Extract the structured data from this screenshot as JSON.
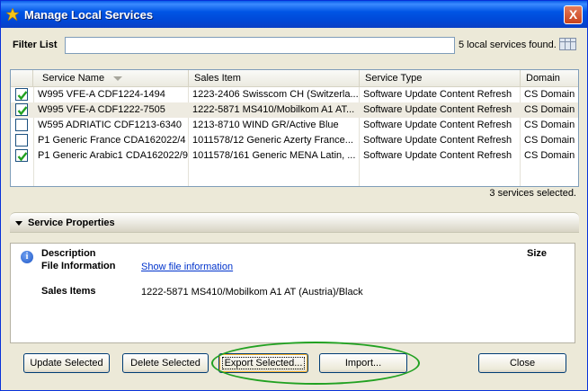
{
  "window": {
    "title": "Manage Local Services",
    "close_label": "X"
  },
  "filter": {
    "label": "Filter List",
    "value": "",
    "placeholder": "",
    "found_text": "5 local services found."
  },
  "table": {
    "columns": [
      "Service Name",
      "Sales Item",
      "Service Type",
      "Domain"
    ],
    "rows": [
      {
        "checked": true,
        "selected": false,
        "name": "W995 VFE-A CDF1224-1494",
        "sales_item": "1223-2406 Swisscom CH (Switzerla...",
        "service_type": "Software Update Content Refresh",
        "domain": "CS Domain"
      },
      {
        "checked": true,
        "selected": true,
        "name": "W995 VFE-A CDF1222-7505",
        "sales_item": "1222-5871 MS410/Mobilkom A1 AT...",
        "service_type": "Software Update Content Refresh",
        "domain": "CS Domain"
      },
      {
        "checked": false,
        "selected": false,
        "name": "W595 ADRIATIC CDF1213-6340",
        "sales_item": "1213-8710 WIND GR/Active Blue",
        "service_type": "Software Update Content Refresh",
        "domain": "CS Domain"
      },
      {
        "checked": false,
        "selected": false,
        "name": "P1 Generic France CDA162022/4",
        "sales_item": "1011578/12 Generic Azerty France...",
        "service_type": "Software Update Content Refresh",
        "domain": "CS Domain"
      },
      {
        "checked": true,
        "selected": false,
        "name": "P1 Generic Arabic1 CDA162022/9",
        "sales_item": "1011578/161 Generic MENA Latin, ...",
        "service_type": "Software Update Content Refresh",
        "domain": "CS Domain"
      }
    ],
    "selected_text": "3 services selected."
  },
  "properties": {
    "title": "Service Properties",
    "description_label": "Description",
    "size_label": "Size",
    "file_info_label": "File Information",
    "file_info_link": "Show file information",
    "sales_items_label": "Sales Items",
    "sales_items_value": "1222-5871 MS410/Mobilkom A1 AT (Austria)/Black"
  },
  "buttons": {
    "update": "Update Selected",
    "delete": "Delete Selected",
    "export": "Export Selected...",
    "import": "Import...",
    "close": "Close"
  },
  "colors": {
    "title_bar": "#0055e5",
    "highlight_ellipse": "#21a121",
    "check": "#21a121"
  }
}
